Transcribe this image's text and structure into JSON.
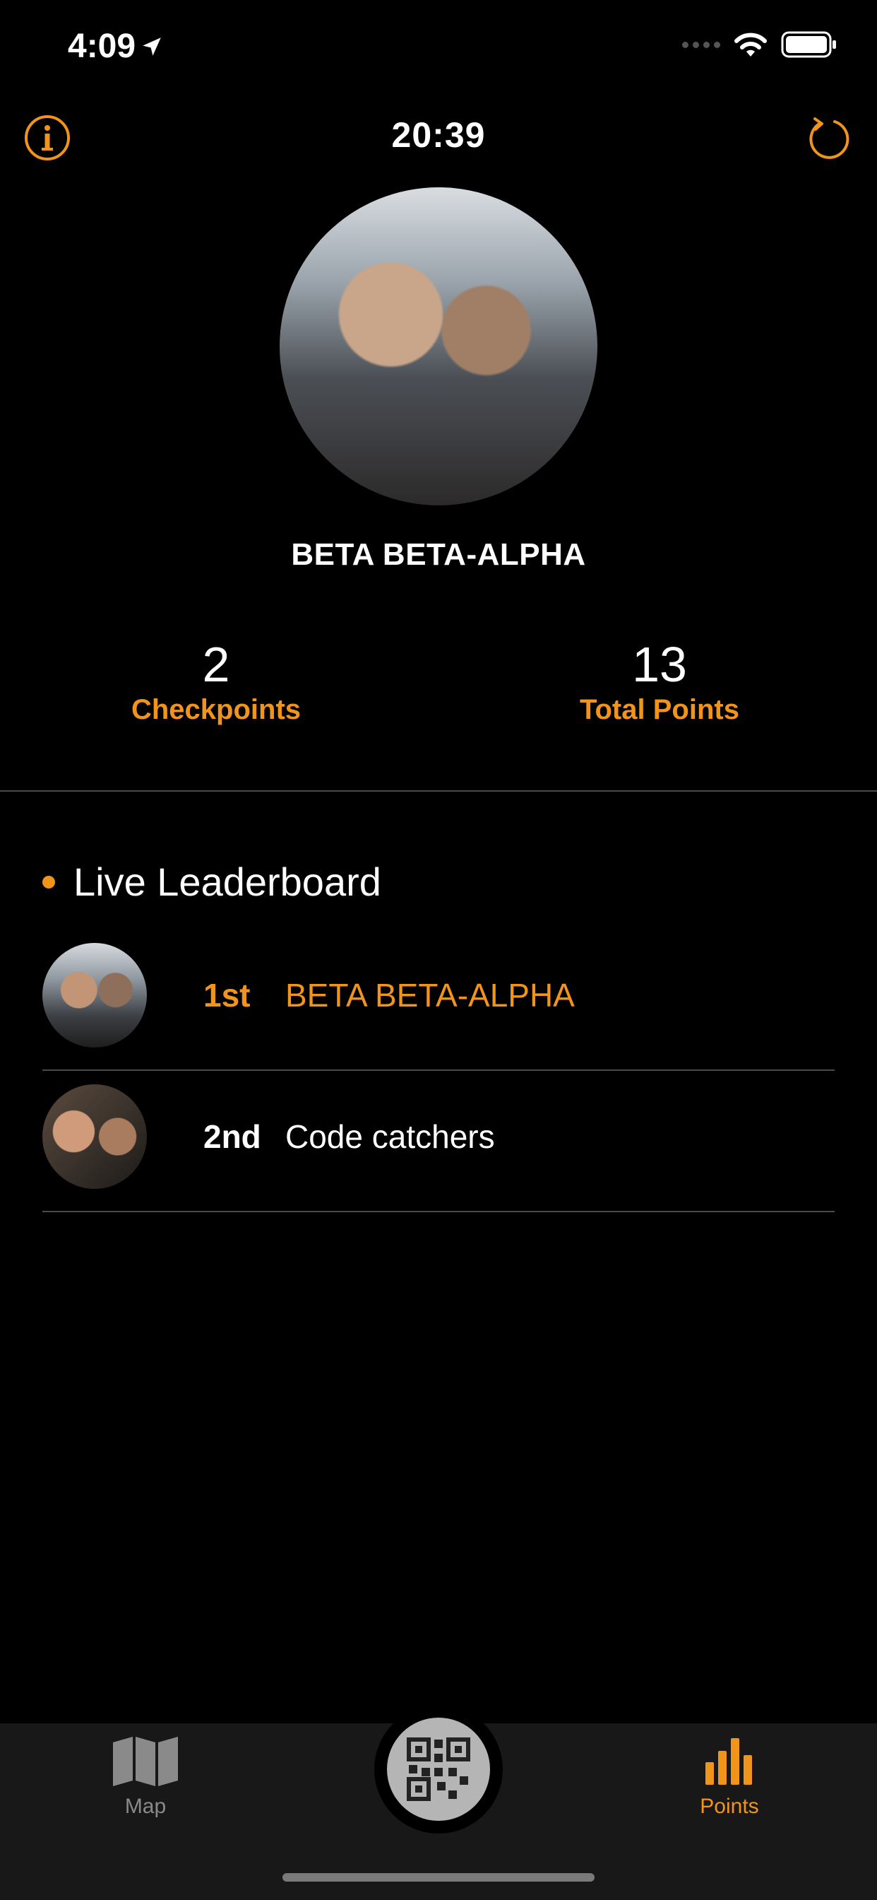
{
  "status_bar": {
    "time": "4:09"
  },
  "header": {
    "timer": "20:39"
  },
  "team": {
    "name": "BETA BETA-ALPHA"
  },
  "stats": {
    "checkpoints_value": "2",
    "checkpoints_label": "Checkpoints",
    "points_value": "13",
    "points_label": "Total Points"
  },
  "leaderboard": {
    "title": "Live Leaderboard",
    "rows": [
      {
        "rank": "1st",
        "name": "BETA BETA-ALPHA"
      },
      {
        "rank": "2nd",
        "name": "Code catchers"
      }
    ]
  },
  "tabbar": {
    "map_label": "Map",
    "points_label": "Points"
  },
  "colors": {
    "accent": "#f0941c",
    "background": "#000000",
    "tabbar_bg": "#181818",
    "divider": "#4a4a4a"
  },
  "icons": {
    "info": "info-icon",
    "refresh": "refresh-icon",
    "location": "location-arrow-icon",
    "wifi": "wifi-icon",
    "battery": "battery-icon",
    "map": "map-icon",
    "points": "bar-chart-icon",
    "qr": "qr-code-icon"
  }
}
